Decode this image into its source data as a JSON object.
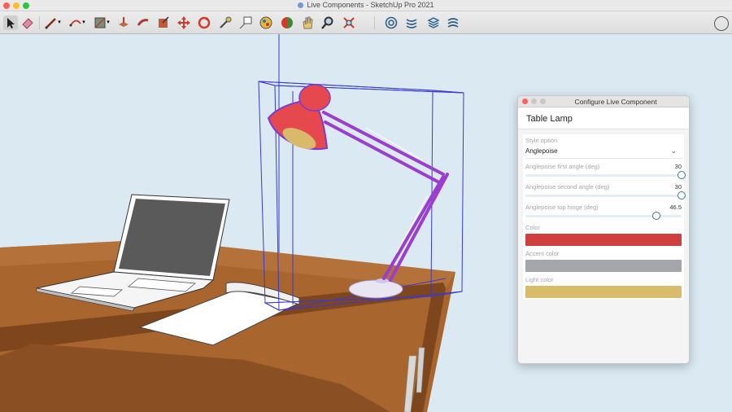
{
  "window": {
    "title": "Live Components - SketchUp Pro 2021"
  },
  "toolbar": {
    "tools": [
      {
        "name": "select-tool-icon",
        "glyph": "↖"
      },
      {
        "name": "eraser-tool-icon",
        "glyph": "◇"
      },
      {
        "name": "line-tool-icon",
        "glyph": "✎"
      },
      {
        "name": "arc-tool-icon",
        "glyph": "◠"
      },
      {
        "name": "shape-tool-icon",
        "glyph": "▨"
      },
      {
        "name": "push-pull-tool-icon",
        "glyph": "⬙"
      },
      {
        "name": "follow-me-tool-icon",
        "glyph": "➶"
      },
      {
        "name": "offset-tool-icon",
        "glyph": "◪"
      },
      {
        "name": "move-tool-icon",
        "glyph": "✥"
      },
      {
        "name": "rotate-tool-icon",
        "glyph": "⟳"
      },
      {
        "name": "tape-measure-tool-icon",
        "glyph": "⟋"
      },
      {
        "name": "text-tool-icon",
        "glyph": "A"
      },
      {
        "name": "paint-bucket-tool-icon",
        "glyph": "◕"
      },
      {
        "name": "orbit-tool-icon",
        "glyph": "◑"
      },
      {
        "name": "pan-tool-icon",
        "glyph": "✋"
      },
      {
        "name": "zoom-tool-icon",
        "glyph": "⌕"
      },
      {
        "name": "zoom-extents-tool-icon",
        "glyph": "⤧"
      },
      {
        "name": "warehouse-icon",
        "glyph": "◎"
      },
      {
        "name": "extension-warehouse-icon",
        "glyph": "≋"
      },
      {
        "name": "layout-icon",
        "glyph": "☰"
      },
      {
        "name": "live-components-icon",
        "glyph": "≈"
      }
    ]
  },
  "panel": {
    "title": "Configure Live Component",
    "component_name": "Table Lamp",
    "style_option": {
      "label": "Style option",
      "value": "Anglepoise"
    },
    "sliders": [
      {
        "label": "Anglepoise first angle (deg)",
        "value": "30",
        "fraction": 1.0
      },
      {
        "label": "Anglepoise second angle (deg)",
        "value": "30",
        "fraction": 1.0
      },
      {
        "label": "Anglepoise top hinge (deg)",
        "value": "46.5",
        "fraction": 0.84
      }
    ],
    "colors": [
      {
        "label": "Color",
        "hex": "#cf3f3e"
      },
      {
        "label": "Accent color",
        "hex": "#a5a5ad"
      },
      {
        "label": "Light color",
        "hex": "#d9bb6c"
      }
    ]
  }
}
